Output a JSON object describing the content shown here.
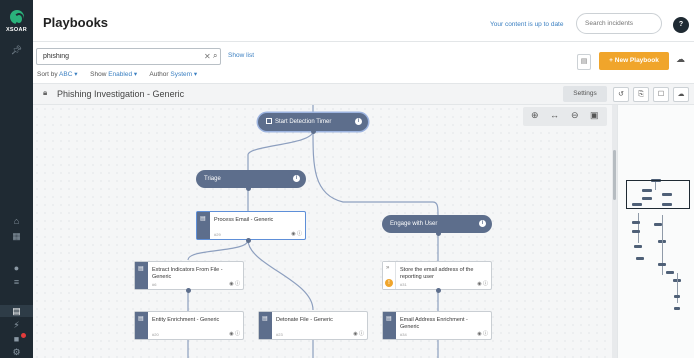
{
  "sidebar": {
    "logo_text": "XSOAR",
    "icons": [
      "pin-icon",
      "home-icon",
      "dashboard-icon",
      "incidents-icon",
      "indicators-icon",
      "playbooks-icon",
      "automation-icon",
      "jobs-icon",
      "settings-icon"
    ]
  },
  "topbar": {
    "title": "Playbooks",
    "status": "Your content is up to date",
    "search_placeholder": "Search incidents",
    "help": "?"
  },
  "listbar": {
    "search_value": "phishing",
    "show_list": "Show list",
    "sort_label": "Sort by",
    "sort_value": "ABC",
    "show_label": "Show",
    "show_value": "Enabled",
    "author_label": "Author",
    "author_value": "System",
    "new_playbook": "+ New Playbook"
  },
  "playbook": {
    "title": "Phishing Investigation - Generic",
    "settings": "Settings"
  },
  "nodes": {
    "start": "Start Detection Timer",
    "triage": "Triage",
    "engage": "Engage with User",
    "process_email": "Process Email - Generic",
    "process_email_id": "#29",
    "extract_indicators": "Extract Indicators From File - Generic",
    "extract_indicators_id": "#6",
    "store_email": "Store the email address of the reporting user",
    "store_email_id": "#31",
    "entity_enrichment": "Entity Enrichment - Generic",
    "entity_enrichment_id": "#20",
    "detonate_file": "Detonate File - Generic",
    "detonate_file_id": "#23",
    "email_enrichment": "Email Address Enrichment - Generic",
    "email_enrichment_id": "#34"
  },
  "colors": {
    "sidebar": "#1f2a33",
    "accent": "#f0a52b",
    "node": "#5d6e8c",
    "link": "#3a7fc1"
  }
}
